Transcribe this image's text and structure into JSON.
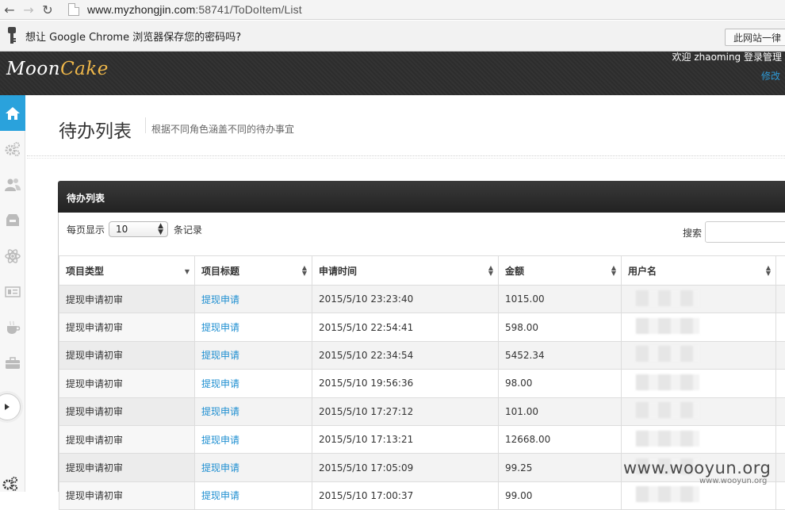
{
  "browser": {
    "url_host": "www.myzhongjin.com",
    "url_rest": ":58741/ToDoItem/List",
    "infobar_text": "想让 Google Chrome 浏览器保存您的密码吗?",
    "never_button": "此网站一律"
  },
  "header": {
    "logo_main": "Moon",
    "logo_accent": "Cake",
    "welcome": "欢迎 zhaoming 登录管理",
    "modify_link": "修改"
  },
  "sidebar": {
    "items": [
      "home-icon",
      "gears-icon",
      "users-icon",
      "inbox-icon",
      "atom-icon",
      "list-icon",
      "coffee-icon",
      "briefcase-icon"
    ],
    "active_color": "#2aa2dc"
  },
  "page": {
    "title": "待办列表",
    "subtitle": "根据不同角色涵盖不同的待办事宜"
  },
  "panel": {
    "title": "待办列表",
    "length_label": "每页显示",
    "length_value": "10",
    "length_suffix": "条记录",
    "search_label": "搜索"
  },
  "table": {
    "columns": [
      "项目类型",
      "项目标题",
      "申请时间",
      "金额",
      "用户名"
    ],
    "rows": [
      {
        "type": "提现申请初审",
        "title": "提现申请",
        "time": "2015/5/10 23:23:40",
        "amount": "1015.00"
      },
      {
        "type": "提现申请初审",
        "title": "提现申请",
        "time": "2015/5/10 22:54:41",
        "amount": "598.00"
      },
      {
        "type": "提现申请初审",
        "title": "提现申请",
        "time": "2015/5/10 22:34:54",
        "amount": "5452.34"
      },
      {
        "type": "提现申请初审",
        "title": "提现申请",
        "time": "2015/5/10 19:56:36",
        "amount": "98.00"
      },
      {
        "type": "提现申请初审",
        "title": "提现申请",
        "time": "2015/5/10 17:27:12",
        "amount": "101.00"
      },
      {
        "type": "提现申请初审",
        "title": "提现申请",
        "time": "2015/5/10 17:13:21",
        "amount": "12668.00"
      },
      {
        "type": "提现申请初审",
        "title": "提现申请",
        "time": "2015/5/10 17:05:09",
        "amount": "99.25"
      },
      {
        "type": "提现申请初审",
        "title": "提现申请",
        "time": "2015/5/10 17:00:37",
        "amount": "99.00"
      }
    ]
  },
  "watermark": {
    "big": "www.wooyun.org",
    "small": "www.wooyun.org"
  },
  "colors": {
    "link": "#1f8fd1",
    "logo_accent": "#f0b84a"
  }
}
